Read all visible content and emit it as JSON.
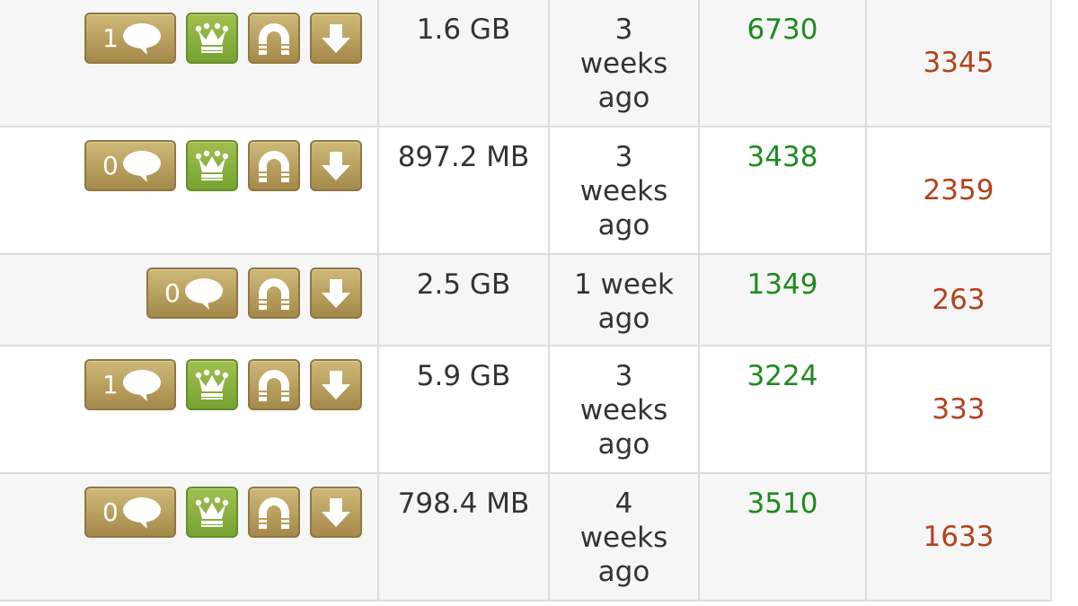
{
  "colors": {
    "button_gold": "#b89f5c",
    "button_vip_green": "#86af3a",
    "seeders_green": "#1e8a1e",
    "leechers_red": "#b2421c",
    "row_alt_bg": "#f6f6f6"
  },
  "icons": {
    "comment": "speech-bubble-icon",
    "vip": "crown-icon",
    "magnet": "magnet-icon",
    "download": "download-arrow-icon"
  },
  "rows": [
    {
      "comments": "1",
      "vip": true,
      "size": "1.6 GB",
      "age": "3\nweeks\nago",
      "seeders": "6730",
      "leechers": "3345"
    },
    {
      "comments": "0",
      "vip": true,
      "size": "897.2 MB",
      "age": "3\nweeks\nago",
      "seeders": "3438",
      "leechers": "2359"
    },
    {
      "comments": "0",
      "vip": false,
      "size": "2.5 GB",
      "age": "1 week\nago",
      "seeders": "1349",
      "leechers": "263"
    },
    {
      "comments": "1",
      "vip": true,
      "size": "5.9 GB",
      "age": "3\nweeks\nago",
      "seeders": "3224",
      "leechers": "333"
    },
    {
      "comments": "0",
      "vip": true,
      "size": "798.4 MB",
      "age": "4\nweeks\nago",
      "seeders": "3510",
      "leechers": "1633"
    }
  ]
}
